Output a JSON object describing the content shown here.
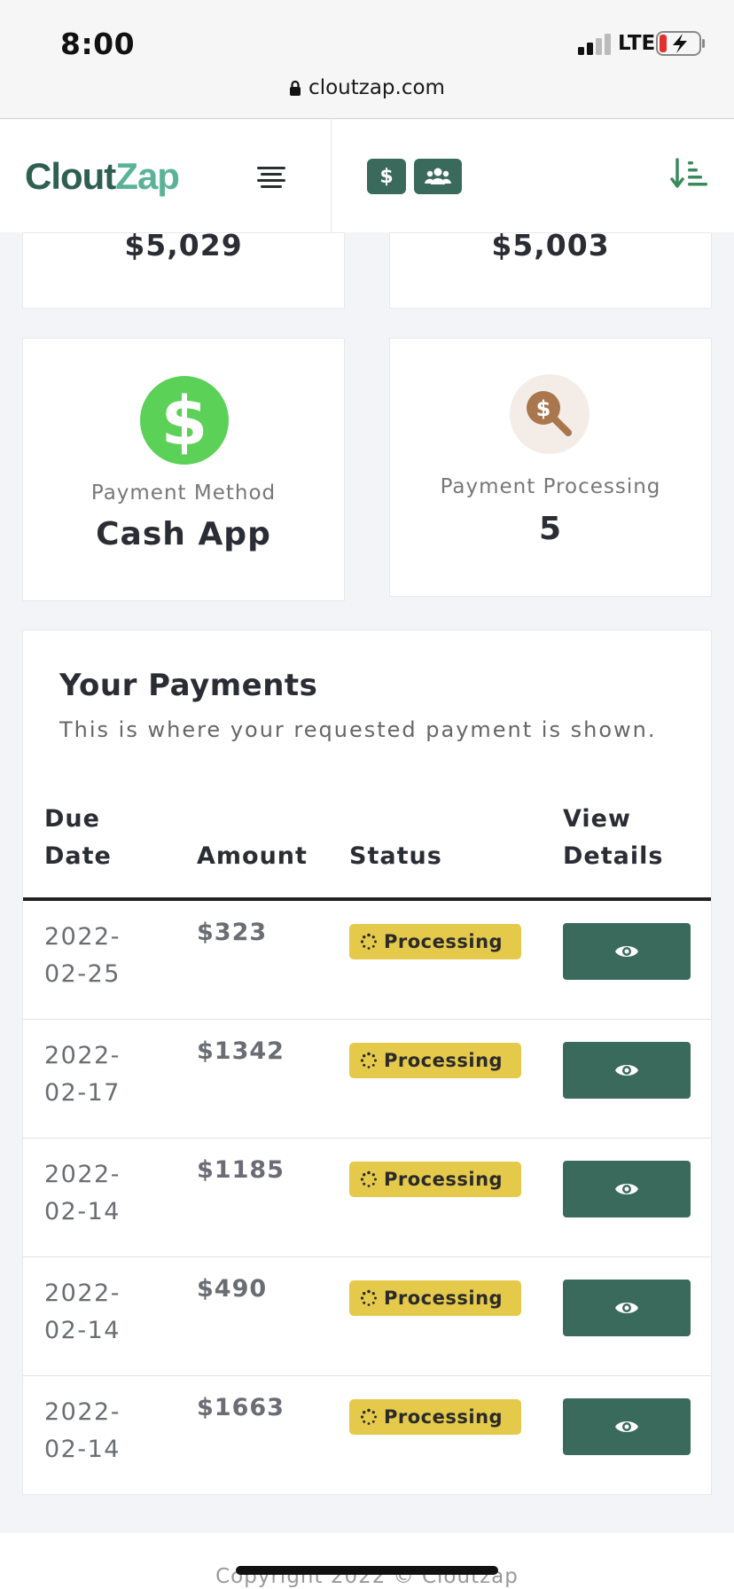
{
  "status_bar": {
    "time": "8:00",
    "network": "LTE",
    "url": "cloutzap.com"
  },
  "header": {
    "logo_part1": "Clout",
    "logo_part2": "Zap",
    "dollar_button": "$",
    "icons": [
      "menu-icon",
      "dollar-icon",
      "users-icon",
      "sort-amount-icon"
    ]
  },
  "stats": {
    "top_left_amount": "$5,029",
    "top_right_amount": "$5,003",
    "payment_method_label": "Payment Method",
    "payment_method_value": "Cash App",
    "payment_processing_label": "Payment Processing",
    "payment_processing_value": "5"
  },
  "payments": {
    "title": "Your Payments",
    "subtitle": "This is where your requested payment is shown.",
    "columns": {
      "due_date_1": "Due",
      "due_date_2": "Date",
      "amount": "Amount",
      "status": "Status",
      "view_details_1": "View",
      "view_details_2": "Details"
    },
    "rows": [
      {
        "date_1": "2022-",
        "date_2": "02-25",
        "amount": "$323",
        "status": "Processing"
      },
      {
        "date_1": "2022-",
        "date_2": "02-17",
        "amount": "$1342",
        "status": "Processing"
      },
      {
        "date_1": "2022-",
        "date_2": "02-14",
        "amount": "$1185",
        "status": "Processing"
      },
      {
        "date_1": "2022-",
        "date_2": "02-14",
        "amount": "$490",
        "status": "Processing"
      },
      {
        "date_1": "2022-",
        "date_2": "02-14",
        "amount": "$1663",
        "status": "Processing"
      }
    ]
  },
  "footer": {
    "copyright": "Copyright 2022 © Cloutzap"
  },
  "colors": {
    "brand_dark": "#3a6a5b",
    "brand_light": "#5ab397",
    "badge": "#e5c94a",
    "cash_app": "#5bd158"
  }
}
